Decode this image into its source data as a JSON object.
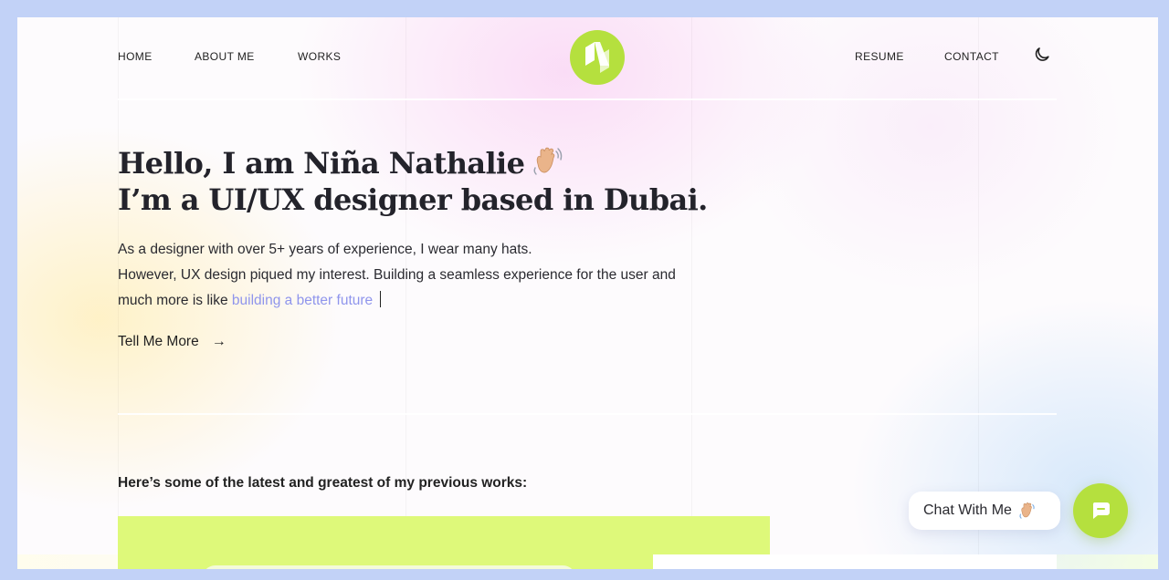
{
  "nav": {
    "left": [
      "HOME",
      "ABOUT ME",
      "WORKS"
    ],
    "right": [
      "RESUME",
      "CONTACT"
    ],
    "logo_icon": "logo-n-mark",
    "theme_icon": "moon-icon"
  },
  "hero": {
    "line1": "Hello, I am Niña Nathalie",
    "line1_icon": "waving-hand-icon",
    "line2": "I’m a UI/UX designer based in Dubai.",
    "intro_line1": "As a designer with over 5+ years of experience, I wear many hats.",
    "intro_line2": "However, UX design piqued my interest. Building a seamless experience for the user and",
    "intro_line3_prefix": "much more is like ",
    "intro_highlight": "building a better future",
    "cta_label": "Tell Me More",
    "cta_arrow": "→"
  },
  "works": {
    "heading": "Here’s some of the latest and greatest of my previous works:"
  },
  "chat": {
    "label": "Chat With Me",
    "label_icon": "waving-hand-icon",
    "button_icon": "chat-bubble-icon"
  },
  "colors": {
    "accent_lime": "#b5e03e",
    "card_lime": "#def97a",
    "highlight_text": "#8f95ec",
    "window_border": "#c2d2f7"
  }
}
